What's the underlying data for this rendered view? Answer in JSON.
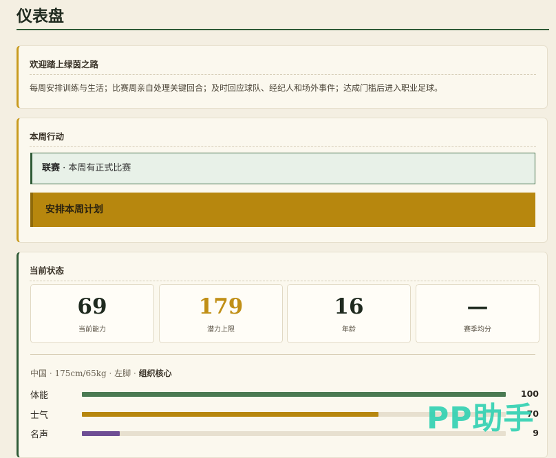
{
  "page": {
    "title": "仪表盘"
  },
  "welcome": {
    "heading": "欢迎踏上绿茵之路",
    "text": "每周安排训练与生活；比赛周亲自处理关键回合；及时回应球队、经纪人和场外事件；达成门槛后进入职业足球。"
  },
  "week": {
    "heading": "本周行动",
    "league_label": "联赛",
    "league_text": " · 本周有正式比赛",
    "plan_button": "安排本周计划"
  },
  "status": {
    "heading": "当前状态",
    "stats": [
      {
        "value": "69",
        "label": "当前能力"
      },
      {
        "value": "179",
        "label": "潜力上限"
      },
      {
        "value": "16",
        "label": "年龄"
      },
      {
        "value": "—",
        "label": "赛季均分"
      }
    ],
    "profile_text": "中国 · 175cm/65kg · 左脚 · ",
    "profile_role": "组织核心",
    "attributes": [
      {
        "label": "体能",
        "value": "100",
        "fraction": 1.0,
        "color": "#4a7a52"
      },
      {
        "label": "士气",
        "value": "70",
        "fraction": 0.7,
        "color": "#b7870e"
      },
      {
        "label": "名声",
        "value": "9",
        "fraction": 0.09,
        "color": "#6e4e94"
      }
    ]
  },
  "watermark": {
    "text": "PP助手"
  }
}
